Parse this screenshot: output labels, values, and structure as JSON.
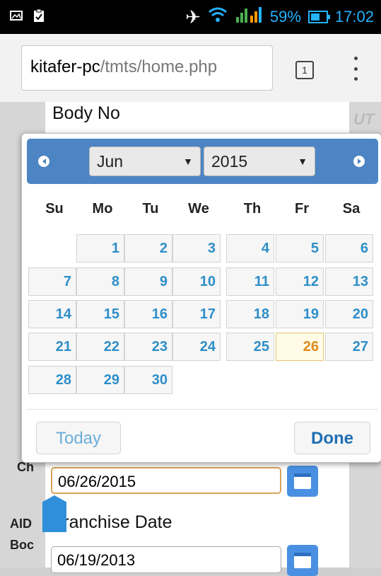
{
  "status_bar": {
    "battery": "59%",
    "time": "17:02"
  },
  "browser": {
    "url_host": "kitafer-pc",
    "url_path": "/tmts/home.php",
    "tab_count": "1"
  },
  "form": {
    "body_no_label": "Body No",
    "arrival_date_value": "06/26/2015",
    "franchise_label": "Franchise Date",
    "franchise_date_value": "06/19/2013"
  },
  "background": {
    "aid": "AID",
    "bod": "Boc",
    "ch": "Ch",
    "ut": "UT"
  },
  "datepicker": {
    "month": "Jun",
    "year": "2015",
    "weekdays": [
      "Su",
      "Mo",
      "Tu",
      "We",
      "Th",
      "Fr",
      "Sa"
    ],
    "days": [
      [
        "",
        "1",
        "2",
        "3",
        "4",
        "5",
        "6"
      ],
      [
        "7",
        "8",
        "9",
        "10",
        "11",
        "12",
        "13"
      ],
      [
        "14",
        "15",
        "16",
        "17",
        "18",
        "19",
        "20"
      ],
      [
        "21",
        "22",
        "23",
        "24",
        "25",
        "26",
        "27"
      ],
      [
        "28",
        "29",
        "30",
        "",
        "",
        "",
        ""
      ]
    ],
    "today": "26",
    "today_label": "Today",
    "done_label": "Done"
  },
  "colors": {
    "header": "#4d85c4",
    "day_text": "#2e8ec8",
    "today_text": "#e08a1d"
  },
  "icons": [
    "image-icon",
    "clipboard-icon",
    "mute-icon",
    "wifi-icon",
    "signal-icon",
    "battery-icon",
    "menu-dots-icon",
    "calendar-icon"
  ]
}
